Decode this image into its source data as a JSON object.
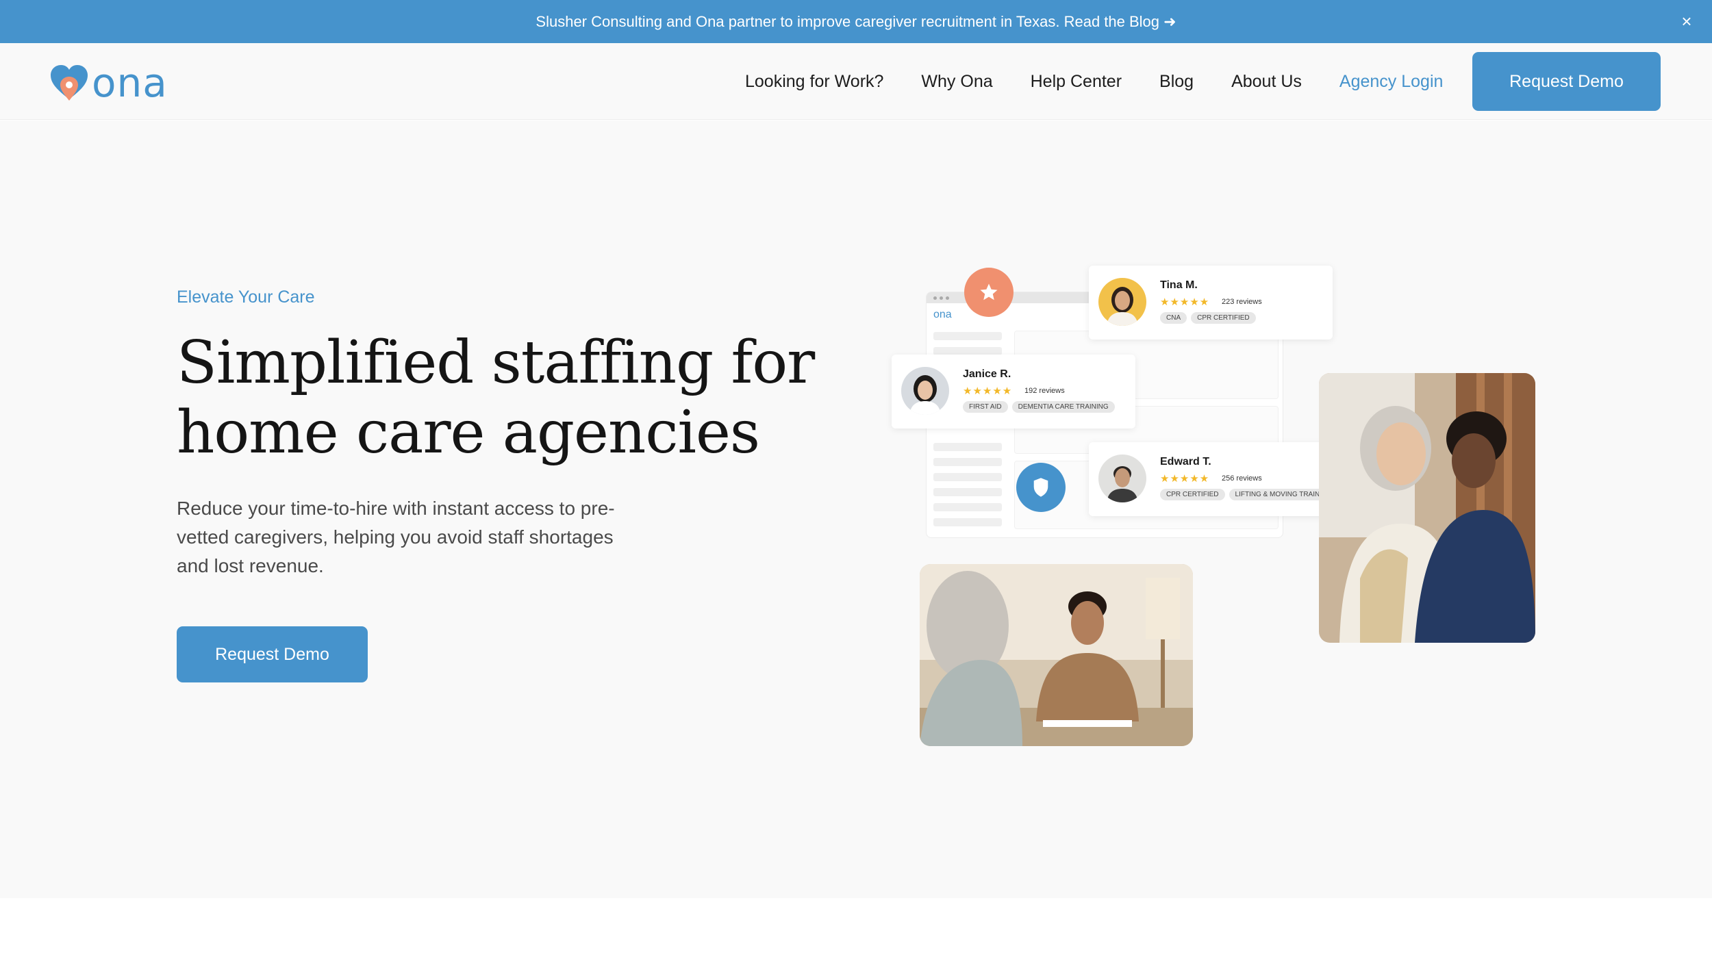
{
  "announcement": {
    "text": "Slusher Consulting and Ona partner to improve caregiver recruitment in Texas. Read the Blog ➜",
    "close": "×"
  },
  "brand": {
    "name": "ona",
    "accent": "#4693cc",
    "secondary": "#f0906f"
  },
  "nav": {
    "items": [
      "Looking for Work?",
      "Why Ona",
      "Help Center",
      "Blog",
      "About Us"
    ],
    "login": "Agency Login",
    "cta": "Request Demo"
  },
  "hero": {
    "eyebrow": "Elevate Your Care",
    "title_line1": "Simplified staffing for",
    "title_line2": "home care agencies",
    "subtitle": "Reduce your time-to-hire with instant access to pre-vetted caregivers, helping you avoid staff shortages and lost revenue.",
    "cta": "Request Demo"
  },
  "illustration": {
    "mock_logo": "ona",
    "cards": [
      {
        "name": "Tina M.",
        "stars": "★★★★★",
        "reviews": "223 reviews",
        "tags": [
          "CNA",
          "CPR CERTIFIED"
        ]
      },
      {
        "name": "Janice R.",
        "stars": "★★★★★",
        "reviews": "192 reviews",
        "tags": [
          "FIRST AID",
          "DEMENTIA CARE TRAINING"
        ]
      },
      {
        "name": "Edward T.",
        "stars": "★★★★★",
        "reviews": "256 reviews",
        "tags": [
          "CPR CERTIFIED",
          "LIFTING & MOVING TRAINING"
        ]
      }
    ],
    "badge_icons": [
      "star-icon",
      "shield-icon"
    ]
  }
}
